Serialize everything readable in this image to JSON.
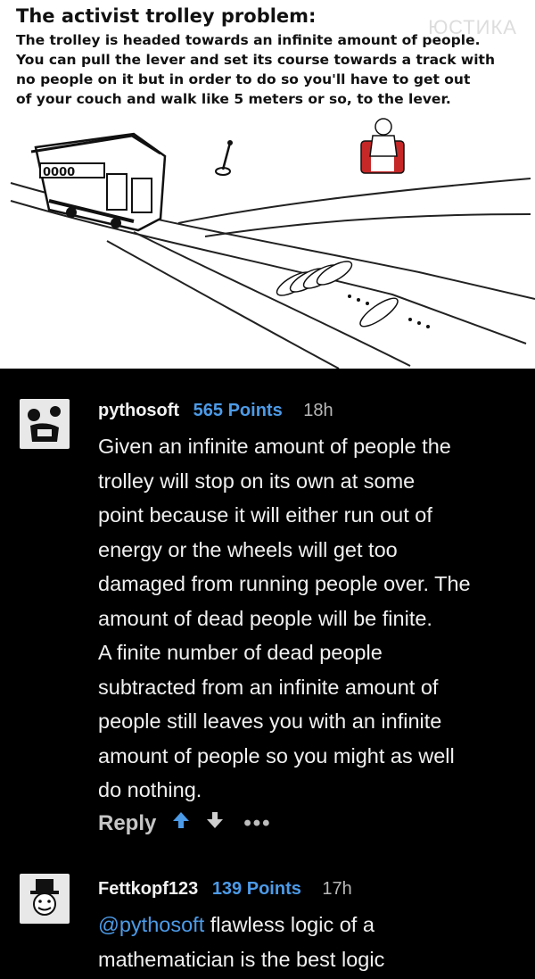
{
  "meme": {
    "title": "The activist trolley problem:",
    "caption_lines": [
      "The trolley is headed towards an infinite amount of people.",
      "You can pull the lever and set its  course towards a track with",
      "no people on it  but in order to do so you'll have to get out",
      "of your couch  and walk  like  5 meters or so, to the lever."
    ],
    "watermark": "ЮСТИКА"
  },
  "comments": [
    {
      "username": "pythosoft",
      "points": "565 Points",
      "time": "18h",
      "avatar_icon": "rage-face-avatar-icon",
      "lines": [
        "Given an infinite amount of people the",
        "trolley will stop on its own at some",
        "point because it will either run out of",
        "energy or the wheels will get too",
        "damaged from running people over. The",
        "amount of dead people will be finite.",
        "A finite number of dead people",
        "subtracted from an infinite amount of",
        "people still leaves you with an infinite",
        "amount of people so you might as well",
        "do nothing."
      ],
      "reply_label": "Reply",
      "more_label": "•••"
    },
    {
      "username": "Fettkopf123",
      "points": "139 Points",
      "time": "17h",
      "avatar_icon": "top-hat-face-avatar-icon",
      "mention": "@pythosoft",
      "line1_rest": " flawless logic of a",
      "line2": "mathematician is the best logic"
    }
  ],
  "colors": {
    "background": "#000000",
    "points": "#4c9be8",
    "text": "#f0f0f0"
  }
}
